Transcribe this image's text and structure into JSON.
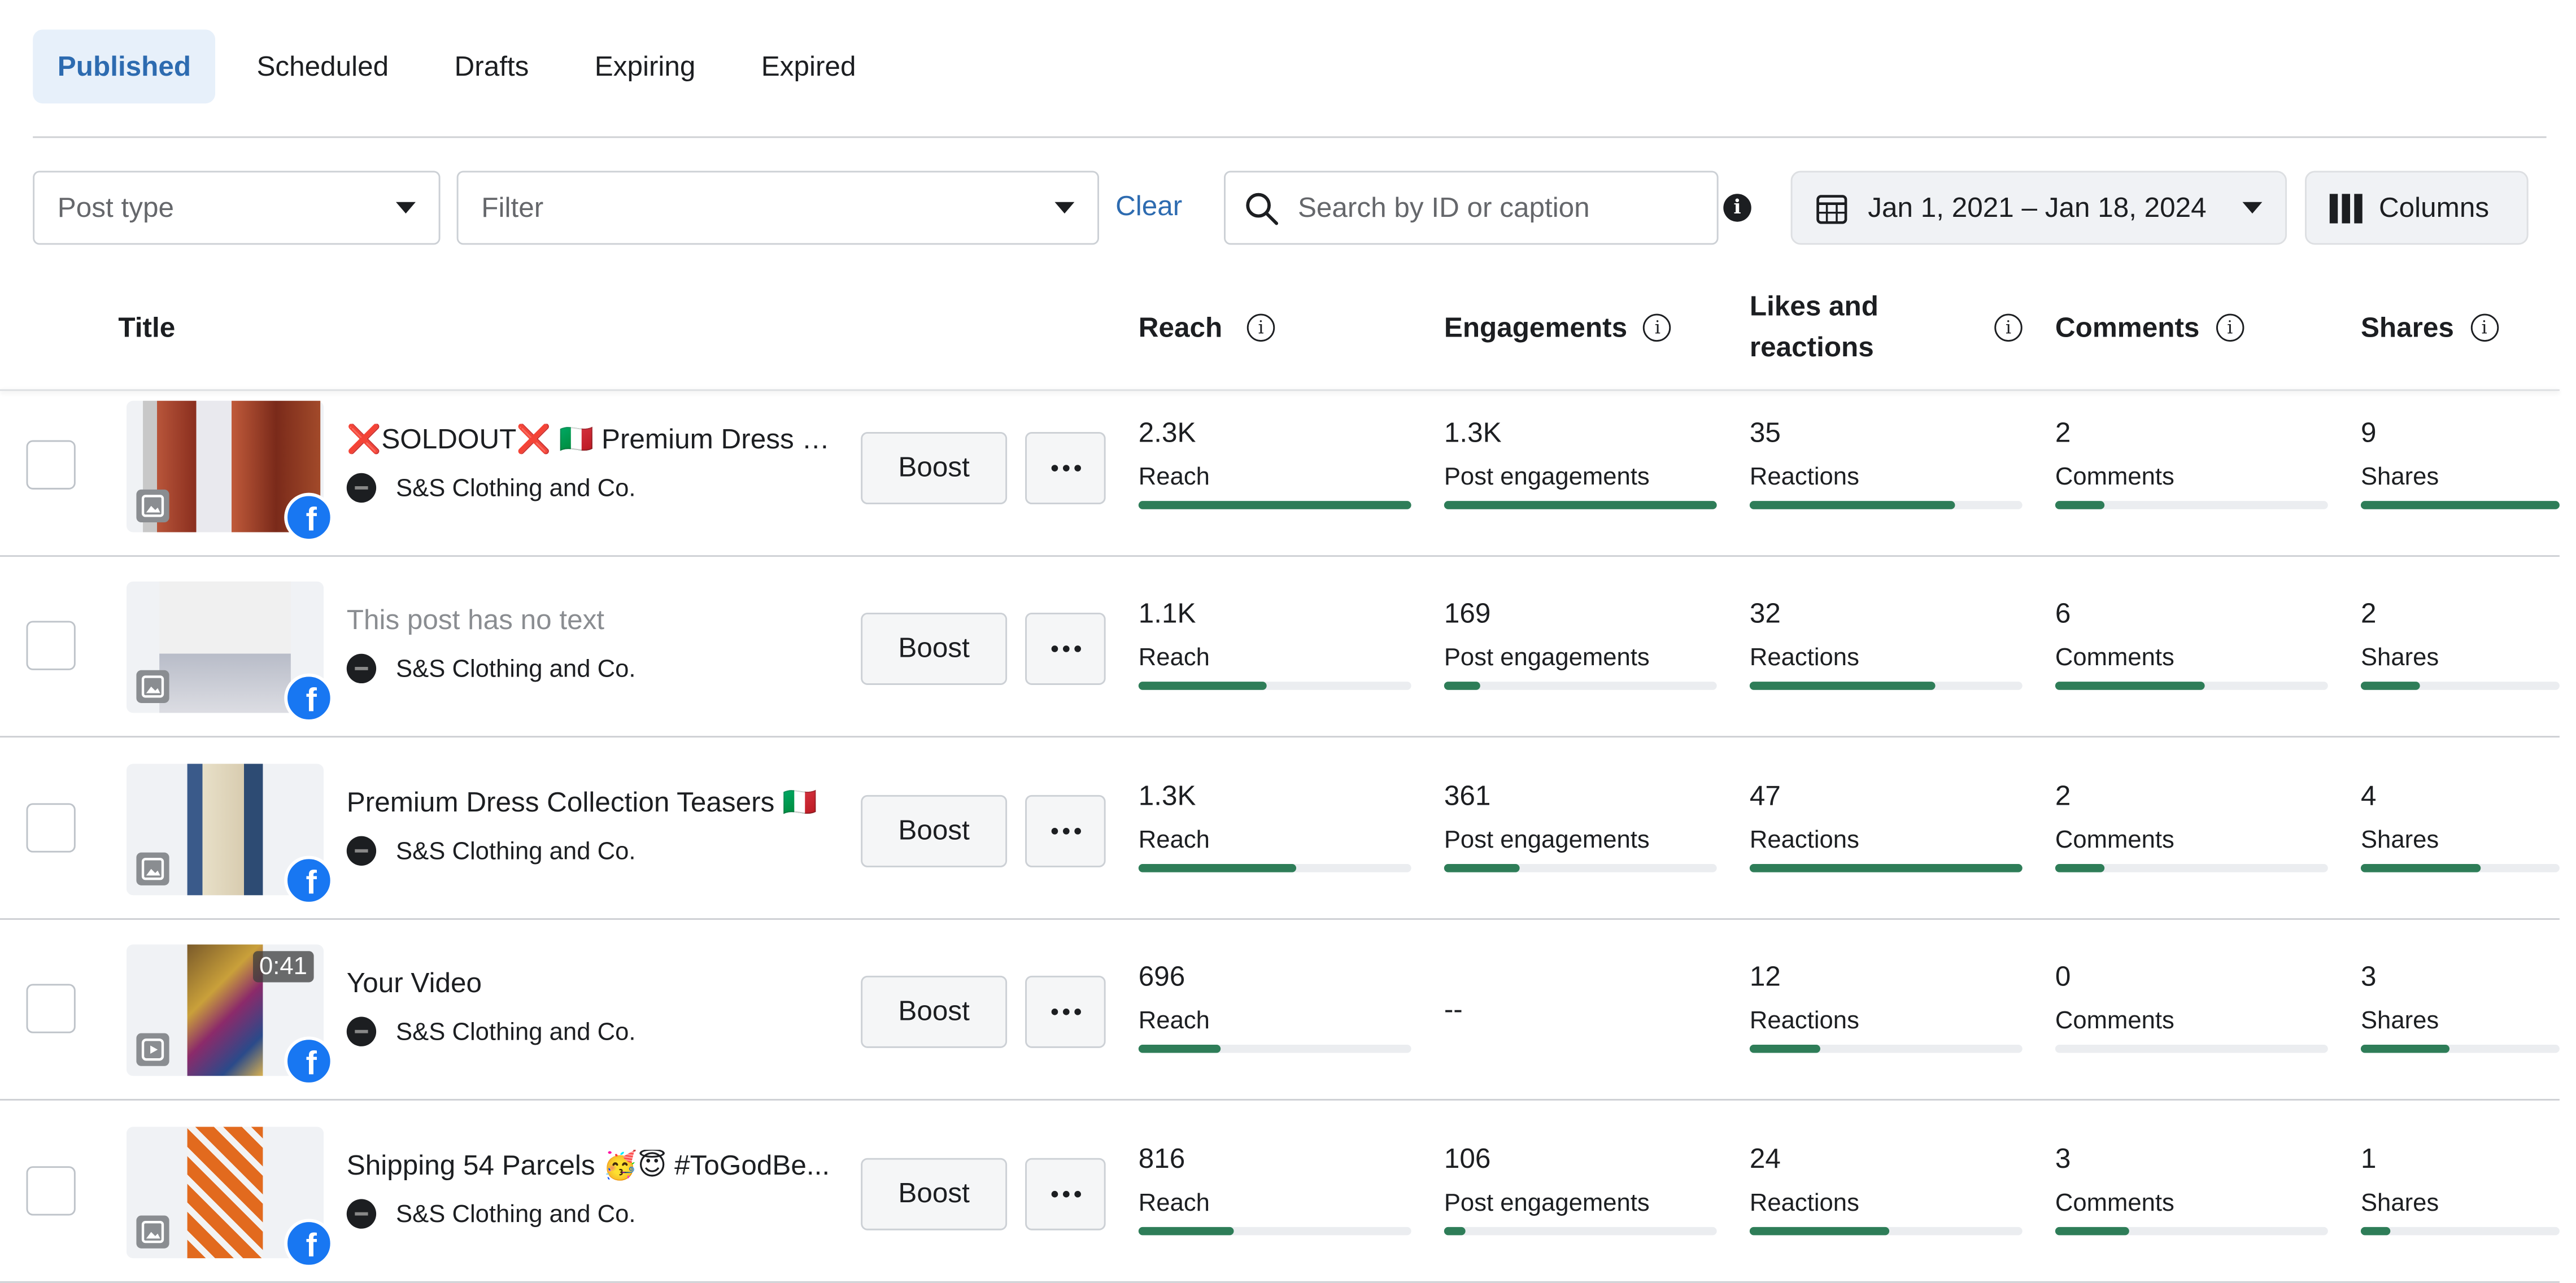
{
  "tabs": [
    {
      "label": "Published",
      "active": true
    },
    {
      "label": "Scheduled",
      "active": false
    },
    {
      "label": "Drafts",
      "active": false
    },
    {
      "label": "Expiring",
      "active": false
    },
    {
      "label": "Expired",
      "active": false
    }
  ],
  "toolbar": {
    "post_type_placeholder": "Post type",
    "filter_placeholder": "Filter",
    "clear_label": "Clear",
    "search_placeholder": "Search by ID or caption",
    "date_range": "Jan 1, 2021 – Jan 18, 2024",
    "columns_label": "Columns"
  },
  "header": {
    "title": "Title",
    "reach": "Reach",
    "engagements": "Engagements",
    "likes_line1": "Likes and",
    "likes_line2": "reactions",
    "comments": "Comments",
    "shares": "Shares"
  },
  "colors": {
    "accent": "#2d6bb0",
    "active_tab_bg": "#e7f0fa",
    "bar_fill": "#2e7d58",
    "bar_track": "#ebedf0",
    "facebook_blue": "#1877f2"
  },
  "posts": [
    {
      "title": "❌SOLDOUT❌ 🇮🇹 Premium Dress C...",
      "title_muted": false,
      "page": "S&S Clothing and Co.",
      "boost": "Boost",
      "post_type_icon": "photo-icon",
      "duration": "",
      "reach": {
        "value": "2.3K",
        "label": "Reach",
        "fill": 1.0
      },
      "engagements": {
        "value": "1.3K",
        "label": "Post engagements",
        "fill": 1.0
      },
      "reactions": {
        "value": "35",
        "label": "Reactions",
        "fill": 0.75
      },
      "comments": {
        "value": "2",
        "label": "Comments",
        "fill": 0.18
      },
      "shares": {
        "value": "9",
        "label": "Shares",
        "fill": 1.0
      }
    },
    {
      "title": "This post has no text",
      "title_muted": true,
      "page": "S&S Clothing and Co.",
      "boost": "Boost",
      "post_type_icon": "photo-icon",
      "duration": "",
      "reach": {
        "value": "1.1K",
        "label": "Reach",
        "fill": 0.47
      },
      "engagements": {
        "value": "169",
        "label": "Post engagements",
        "fill": 0.13
      },
      "reactions": {
        "value": "32",
        "label": "Reactions",
        "fill": 0.68
      },
      "comments": {
        "value": "6",
        "label": "Comments",
        "fill": 0.55
      },
      "shares": {
        "value": "2",
        "label": "Shares",
        "fill": 0.3
      }
    },
    {
      "title": "Premium Dress Collection Teasers 🇮🇹",
      "title_muted": false,
      "page": "S&S Clothing and Co.",
      "boost": "Boost",
      "post_type_icon": "photo-icon",
      "duration": "",
      "reach": {
        "value": "1.3K",
        "label": "Reach",
        "fill": 0.58
      },
      "engagements": {
        "value": "361",
        "label": "Post engagements",
        "fill": 0.28
      },
      "reactions": {
        "value": "47",
        "label": "Reactions",
        "fill": 1.0
      },
      "comments": {
        "value": "2",
        "label": "Comments",
        "fill": 0.18
      },
      "shares": {
        "value": "4",
        "label": "Shares",
        "fill": 0.6
      }
    },
    {
      "title": "Your Video",
      "title_muted": false,
      "page": "S&S Clothing and Co.",
      "boost": "Boost",
      "post_type_icon": "video-icon",
      "duration": "0:41",
      "reach": {
        "value": "696",
        "label": "Reach",
        "fill": 0.3
      },
      "engagements": {
        "value": "--",
        "label": "",
        "fill": null
      },
      "reactions": {
        "value": "12",
        "label": "Reactions",
        "fill": 0.26
      },
      "comments": {
        "value": "0",
        "label": "Comments",
        "fill": 0.0
      },
      "shares": {
        "value": "3",
        "label": "Shares",
        "fill": 0.45
      }
    },
    {
      "title": "Shipping 54 Parcels 🥳😇 #ToGodBe...",
      "title_muted": false,
      "page": "S&S Clothing and Co.",
      "boost": "Boost",
      "post_type_icon": "photo-icon",
      "duration": "",
      "reach": {
        "value": "816",
        "label": "Reach",
        "fill": 0.35
      },
      "engagements": {
        "value": "106",
        "label": "Post engagements",
        "fill": 0.08
      },
      "reactions": {
        "value": "24",
        "label": "Reactions",
        "fill": 0.51
      },
      "comments": {
        "value": "3",
        "label": "Comments",
        "fill": 0.27
      },
      "shares": {
        "value": "1",
        "label": "Shares",
        "fill": 0.15
      }
    }
  ]
}
